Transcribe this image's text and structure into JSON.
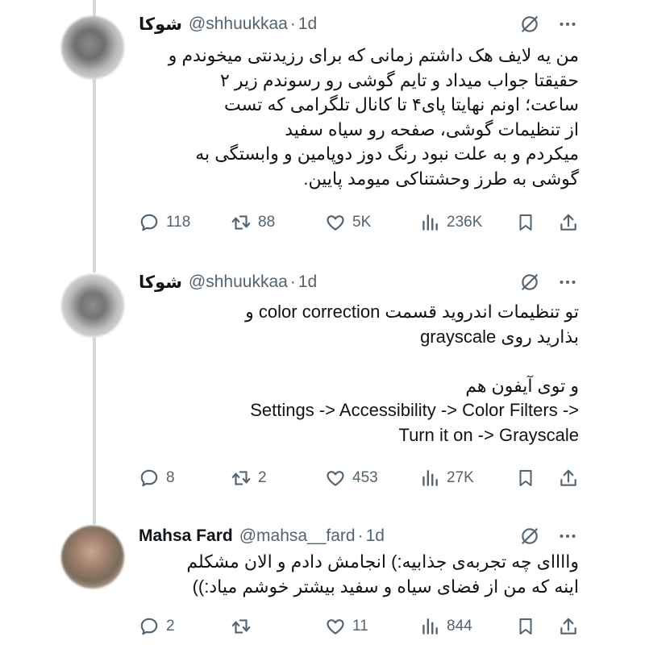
{
  "colors": {
    "text_primary": "#0f1419",
    "text_secondary": "#536471",
    "thread_line": "#cfd9de",
    "background": "#ffffff"
  },
  "icons": {
    "header": [
      "grok-slash-circle-icon",
      "more-horizontal-icon"
    ],
    "actions": [
      "reply-icon",
      "retweet-icon",
      "like-icon",
      "views-icon",
      "bookmark-icon",
      "share-icon"
    ]
  },
  "tweets": [
    {
      "author_name": "شوکا",
      "handle": "@shhuukkaa",
      "time": "1d",
      "text_lines": [
        "من یه لایف هک داشتم زمانی که برای رزیدنتی میخوندم و",
        "حقیقتا جواب میداد و تایم گوشی رو رسوندم زیر ۲",
        "ساعت؛ اونم نهایتا پای۴ تا کانال تلگرامی که تست",
        "از تنظیمات گوشی، صفحه رو سیاه سفید",
        "میکردم و به علت نبود رنگ دوز دوپامین و وابستگی به",
        "گوشی به طرز وحشتناکی میومد پایین."
      ],
      "replies": "118",
      "reposts": "88",
      "likes": "5K",
      "views": "236K"
    },
    {
      "author_name": "شوکا",
      "handle": "@shhuukkaa",
      "time": "1d",
      "text_lines": [
        "تو تنظیمات اندروید قسمت color correction و",
        "بذارید روی grayscale",
        "",
        "و توی آیفون هم",
        "Settings -> Accessibility -> Color Filters ->",
        "Turn it on -> Grayscale"
      ],
      "replies": "8",
      "reposts": "2",
      "likes": "453",
      "views": "27K"
    },
    {
      "author_name": "Mahsa Fard",
      "handle": "@mahsa__fard",
      "time": "1d",
      "text_lines": [
        "واااای چه تجربه‌ی جذابیه:) انجامش دادم و الان مشکلم",
        "اینه که من از فضای سیاه و سفید بیشتر خوشم میاد:))"
      ],
      "replies": "2",
      "reposts": "",
      "likes": "11",
      "views": "844"
    }
  ]
}
